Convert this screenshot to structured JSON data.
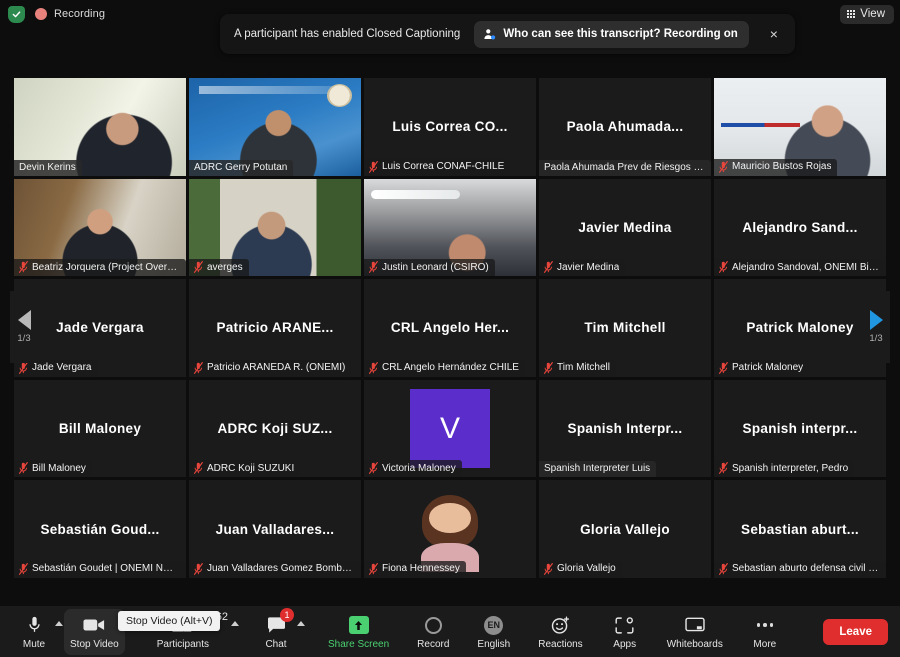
{
  "topbar": {
    "shield_icon": "shield-check-icon",
    "recording_label": "Recording",
    "view_label": "View",
    "view_icon": "grid-icon"
  },
  "notification": {
    "message": "A participant has enabled Closed Captioning",
    "action_label": "Who can see this transcript? Recording on",
    "action_icon": "person-info-icon",
    "close_icon": "close-icon",
    "close_label": "×"
  },
  "gallery": {
    "nav_left": {
      "icon": "chevron-left-icon",
      "page": "1/3"
    },
    "nav_right": {
      "icon": "chevron-right-icon",
      "page": "1/3"
    },
    "tiles": [
      {
        "display_name": "",
        "label": "Devin Kerins",
        "muted": false,
        "active_speaker": true,
        "kind": "video",
        "video": "devin"
      },
      {
        "display_name": "",
        "label": "ADRC Gerry Potutan",
        "muted": false,
        "active_speaker": false,
        "kind": "video",
        "video": "gerry"
      },
      {
        "display_name": "Luis Correa CO...",
        "label": "Luis Correa CONAF-CHILE",
        "muted": true,
        "active_speaker": false,
        "kind": "name"
      },
      {
        "display_name": "Paola  Ahumada...",
        "label": "Paola Ahumada Prev de Riesgos IMVM",
        "muted": false,
        "active_speaker": false,
        "kind": "name"
      },
      {
        "display_name": "",
        "label": "Mauricio Bustos Rojas",
        "muted": true,
        "active_speaker": false,
        "kind": "video",
        "video": "mauricio"
      },
      {
        "display_name": "",
        "label": "Beatriz Jorquera (Project Overseer)",
        "muted": true,
        "active_speaker": false,
        "kind": "video",
        "video": "beatriz"
      },
      {
        "display_name": "",
        "label": "averges",
        "muted": true,
        "active_speaker": false,
        "kind": "video",
        "video": "averges"
      },
      {
        "display_name": "",
        "label": "Justin Leonard (CSIRO)",
        "muted": true,
        "active_speaker": false,
        "kind": "video",
        "video": "justin"
      },
      {
        "display_name": "Javier Medina",
        "label": "Javier Medina",
        "muted": true,
        "active_speaker": false,
        "kind": "name"
      },
      {
        "display_name": "Alejandro  Sand...",
        "label": "Alejandro Sandoval, ONEMI Biobío",
        "muted": true,
        "active_speaker": false,
        "kind": "name"
      },
      {
        "display_name": "Jade Vergara",
        "label": "Jade Vergara",
        "muted": true,
        "active_speaker": false,
        "kind": "name"
      },
      {
        "display_name": "Patricio  ARANE...",
        "label": "Patricio ARANEDA R. (ONEMI)",
        "muted": true,
        "active_speaker": false,
        "kind": "name"
      },
      {
        "display_name": "CRL Angelo Her...",
        "label": "CRL Angelo Hernández CHILE",
        "muted": true,
        "active_speaker": false,
        "kind": "name"
      },
      {
        "display_name": "Tim Mitchell",
        "label": "Tim Mitchell",
        "muted": true,
        "active_speaker": false,
        "kind": "name"
      },
      {
        "display_name": "Patrick Maloney",
        "label": "Patrick Maloney",
        "muted": true,
        "active_speaker": false,
        "kind": "name"
      },
      {
        "display_name": "Bill Maloney",
        "label": "Bill Maloney",
        "muted": true,
        "active_speaker": false,
        "kind": "name"
      },
      {
        "display_name": "ADRC Koji SUZ...",
        "label": "ADRC Koji SUZUKI",
        "muted": true,
        "active_speaker": false,
        "kind": "name"
      },
      {
        "display_name": "",
        "label": "Victoria Maloney",
        "muted": true,
        "active_speaker": false,
        "kind": "avatar",
        "avatar_initial": "V",
        "avatar_color": "#5b2ecb"
      },
      {
        "display_name": "Spanish Interpr...",
        "label": "Spanish Interpreter Luis",
        "muted": false,
        "active_speaker": false,
        "kind": "name"
      },
      {
        "display_name": "Spanish interpr...",
        "label": "Spanish interpreter, Pedro",
        "muted": true,
        "active_speaker": false,
        "kind": "name"
      },
      {
        "display_name": "Sebastián Goud...",
        "label": "Sebastián Goudet | ONEMI ÑUBLE",
        "muted": true,
        "active_speaker": false,
        "kind": "name"
      },
      {
        "display_name": "Juan  Valladares...",
        "label": "Juan Valladares Gomez Bomberos ...",
        "muted": true,
        "active_speaker": false,
        "kind": "name"
      },
      {
        "display_name": "",
        "label": "Fiona Hennessey",
        "muted": true,
        "active_speaker": false,
        "kind": "photo"
      },
      {
        "display_name": "Gloria Vallejo",
        "label": "Gloria Vallejo",
        "muted": true,
        "active_speaker": false,
        "kind": "name"
      },
      {
        "display_name": "Sebastian  aburt...",
        "label": "Sebastian aburto defensa civil chile",
        "muted": true,
        "active_speaker": false,
        "kind": "name"
      }
    ]
  },
  "toolbar": {
    "mute": {
      "label": "Mute",
      "icon": "microphone-icon"
    },
    "stop_video": {
      "label": "Stop Video",
      "icon": "video-camera-icon",
      "tooltip": "Stop Video (Alt+V)"
    },
    "participants": {
      "label": "Participants",
      "icon": "people-icon",
      "count": "62"
    },
    "chat": {
      "label": "Chat",
      "icon": "chat-bubble-icon",
      "badge": "1"
    },
    "share_screen": {
      "label": "Share Screen",
      "icon": "share-screen-icon",
      "color": "#4ad071"
    },
    "record": {
      "label": "Record",
      "icon": "record-circle-icon"
    },
    "english": {
      "label": "English",
      "icon": "language-icon",
      "code": "EN"
    },
    "reactions": {
      "label": "Reactions",
      "icon": "smiley-plus-icon"
    },
    "apps": {
      "label": "Apps",
      "icon": "apps-icon"
    },
    "whiteboards": {
      "label": "Whiteboards",
      "icon": "whiteboard-icon"
    },
    "more": {
      "label": "More",
      "icon": "ellipsis-icon"
    },
    "leave": {
      "label": "Leave",
      "color": "#e02d2d"
    }
  }
}
